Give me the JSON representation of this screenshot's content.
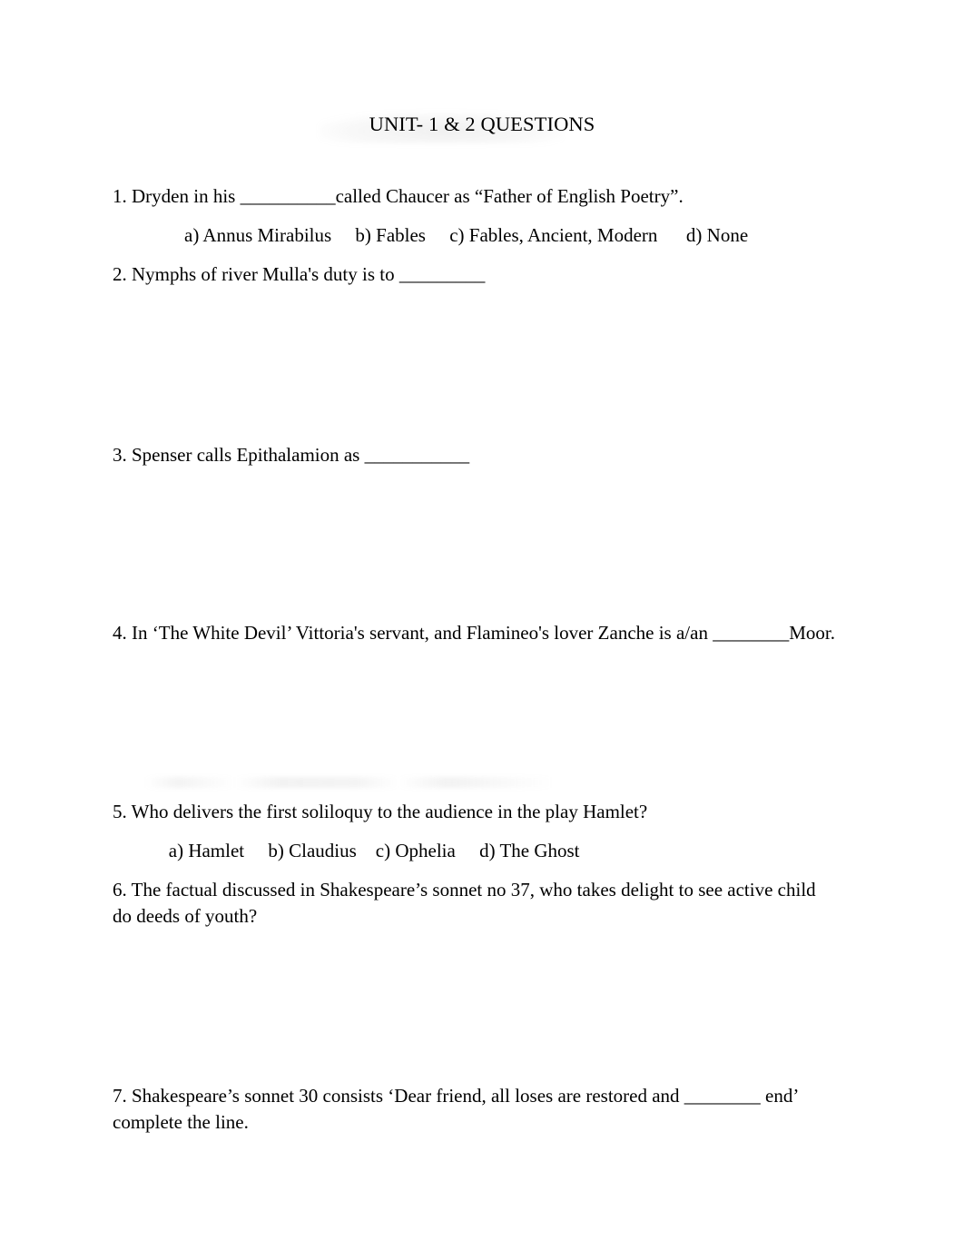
{
  "document": {
    "title": "UNIT- 1 & 2 QUESTIONS",
    "background_color": "#ffffff",
    "text_color": "#000000"
  },
  "questions": [
    {
      "number": "1",
      "text": "1. Dryden in his __________called Chaucer as “Father of English Poetry”.",
      "options_line": "    a) Annus Mirabilus     b) Fables     c) Fables, Ancient, Modern      d) None",
      "has_options": true
    },
    {
      "number": "2",
      "text": "2. Nymphs of river Mulla's duty is to _________",
      "options_line": "",
      "has_options": false
    },
    {
      "number": "3",
      "text": "3. Spenser calls Epithalamion as ___________",
      "options_line": "",
      "has_options": false
    },
    {
      "number": "4",
      "text": "4. In ‘The White Devil’ Vittoria's servant, and Flamineo's lover Zanche is a/an ________Moor.",
      "options_line": "",
      "has_options": false
    },
    {
      "number": "5",
      "text": "5. Who delivers the first soliloquy to the audience in the play Hamlet?",
      "options_line": "   a) Hamlet     b) Claudius    c) Ophelia     d) The Ghost",
      "has_options": true
    },
    {
      "number": "6",
      "text": "6. The factual discussed in Shakespeare’s sonnet no 37, who takes delight to see active child do deeds of youth?",
      "options_line": "",
      "has_options": false
    },
    {
      "number": "7",
      "text": "7. Shakespeare’s sonnet 30 consists ‘Dear friend, all loses are restored and ________ end’ complete the line.",
      "options_line": "",
      "has_options": false
    }
  ]
}
